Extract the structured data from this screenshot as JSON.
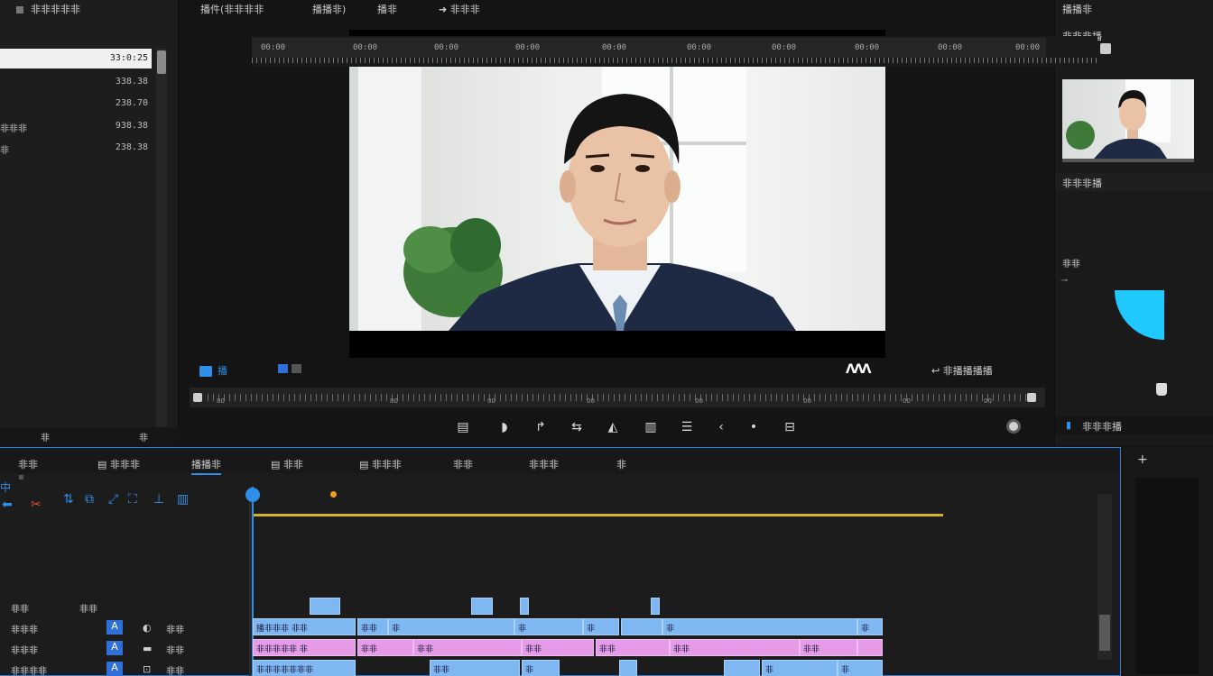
{
  "left_panel": {
    "title": "非非非非非",
    "rows": [
      {
        "name": "",
        "value": "33:0:25"
      },
      {
        "name": "",
        "value": "338.38"
      },
      {
        "name": "",
        "value": "238.70"
      },
      {
        "name": "非非非",
        "value": "938.38"
      },
      {
        "name": "非",
        "value": "238.38"
      }
    ],
    "bottom_left": "非",
    "bottom_right": "非"
  },
  "preview_header": {
    "item1": "播件(非非非非",
    "item2": "播播非)",
    "item3": "播非",
    "item4": "非非非"
  },
  "playback": {
    "mode_label": "播",
    "right_label": "非播播播播",
    "wave_logo": "ΛΛΛ",
    "scrub_labels": [
      "00",
      "00",
      "00",
      "00",
      "00",
      "00",
      "00",
      "00"
    ]
  },
  "transport": [
    "▤",
    "◗",
    "↱",
    "⇆",
    "◭",
    "▥",
    "☰",
    "‹",
    "•",
    "⊟"
  ],
  "right_panel": {
    "title": "播播非",
    "subtitle": "非非非播",
    "section2": "非非非播",
    "side_label": "非非",
    "bottom_label": "非非非播"
  },
  "timeline": {
    "tabs": [
      "非非",
      "非非非",
      "播播非",
      "非非",
      "非非非",
      "非非",
      "非非非",
      "非"
    ],
    "active_tab_index": 2,
    "ruler_labels": [
      "00:00",
      "00:00",
      "00:00",
      "00:00",
      "00:00",
      "00:00",
      "00:00",
      "00:00",
      "00:00",
      "00:00"
    ],
    "tracks": [
      {
        "name": "非非",
        "name2": "非非"
      },
      {
        "name": "非非非",
        "name2": "非非"
      },
      {
        "name": "非非非",
        "name2": "非非"
      },
      {
        "name": "非非非非",
        "name2": "非非"
      }
    ],
    "clip_labels": {
      "v1": [
        "播非非非 非非",
        "非非",
        "非",
        "非",
        "非",
        "",
        "非",
        "非"
      ],
      "a1": [
        "非非非非非 非",
        "非非",
        "非非",
        "非非",
        "非非",
        "非非",
        "非非",
        ""
      ],
      "a2": [
        "非非非非非非非",
        "非非",
        "非",
        "",
        "",
        "非",
        "非"
      ]
    }
  },
  "colors": {
    "accent": "#2f8fe8",
    "clip_blue": "#7fb7f2",
    "clip_pink": "#e59be8",
    "playhead_bar": "#d6b02a"
  }
}
